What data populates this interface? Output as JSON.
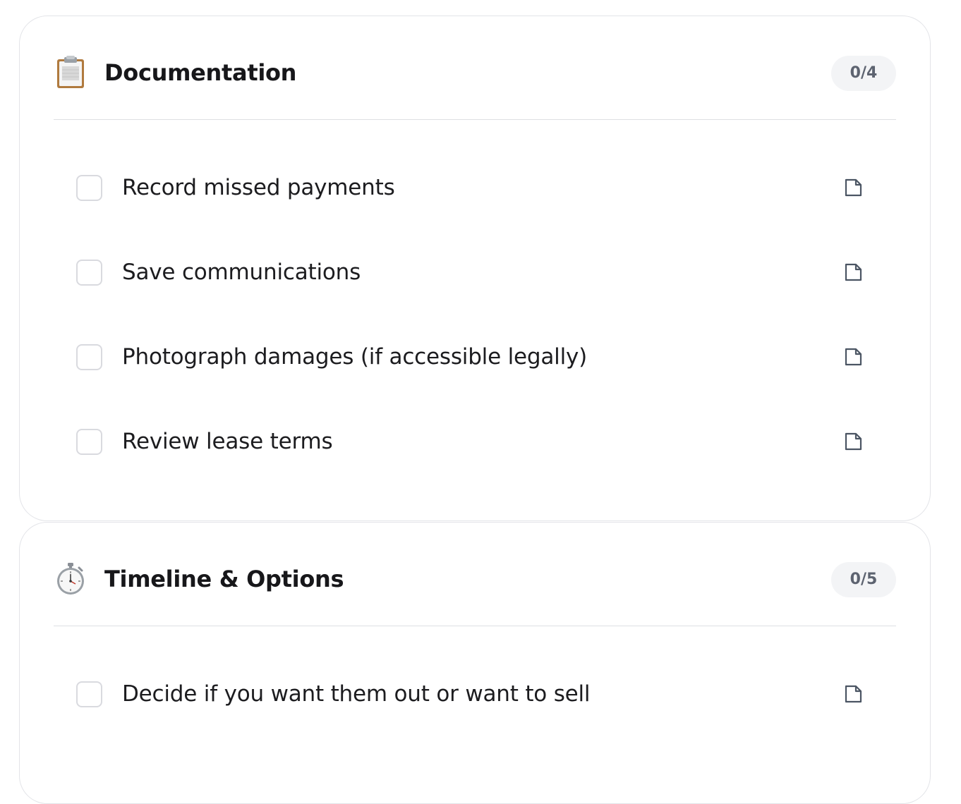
{
  "sections": [
    {
      "icon": "clipboard-icon",
      "title": "Documentation",
      "count": "0/4",
      "tasks": [
        {
          "label": "Record missed payments",
          "checked": false,
          "icon": "note-icon"
        },
        {
          "label": "Save communications",
          "checked": false,
          "icon": "note-icon"
        },
        {
          "label": "Photograph damages (if accessible legally)",
          "checked": false,
          "icon": "note-icon"
        },
        {
          "label": "Review lease terms",
          "checked": false,
          "icon": "note-icon"
        }
      ]
    },
    {
      "icon": "stopwatch-icon",
      "title": "Timeline & Options",
      "count": "0/5",
      "tasks": [
        {
          "label": "Decide if you want them out or want to sell",
          "checked": false,
          "icon": "note-icon"
        }
      ]
    }
  ],
  "colors": {
    "card_border": "#e3e4e8",
    "badge_bg": "#f3f4f6",
    "badge_text": "#5d6370",
    "checkbox_border": "#d9dadf",
    "icon_stroke": "#4b5563"
  }
}
